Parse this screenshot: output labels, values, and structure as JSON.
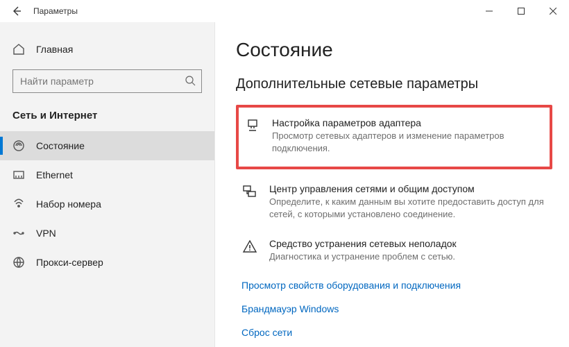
{
  "window": {
    "title": "Параметры"
  },
  "sidebar": {
    "home_label": "Главная",
    "search_placeholder": "Найти параметр",
    "category_title": "Сеть и Интернет",
    "items": [
      {
        "label": "Состояние"
      },
      {
        "label": "Ethernet"
      },
      {
        "label": "Набор номера"
      },
      {
        "label": "VPN"
      },
      {
        "label": "Прокси-сервер"
      }
    ]
  },
  "main": {
    "page_title": "Состояние",
    "section_title": "Дополнительные сетевые параметры",
    "options": [
      {
        "title": "Настройка параметров адаптера",
        "desc": "Просмотр сетевых адаптеров и изменение параметров подключения."
      },
      {
        "title": "Центр управления сетями и общим доступом",
        "desc": "Определите, к каким данным вы хотите предоставить доступ для сетей, с которыми установлено соединение."
      },
      {
        "title": "Средство устранения сетевых неполадок",
        "desc": "Диагностика и устранение проблем с сетью."
      }
    ],
    "links": [
      {
        "label": "Просмотр свойств оборудования и подключения"
      },
      {
        "label": "Брандмауэр Windows"
      },
      {
        "label": "Сброс сети"
      }
    ]
  }
}
